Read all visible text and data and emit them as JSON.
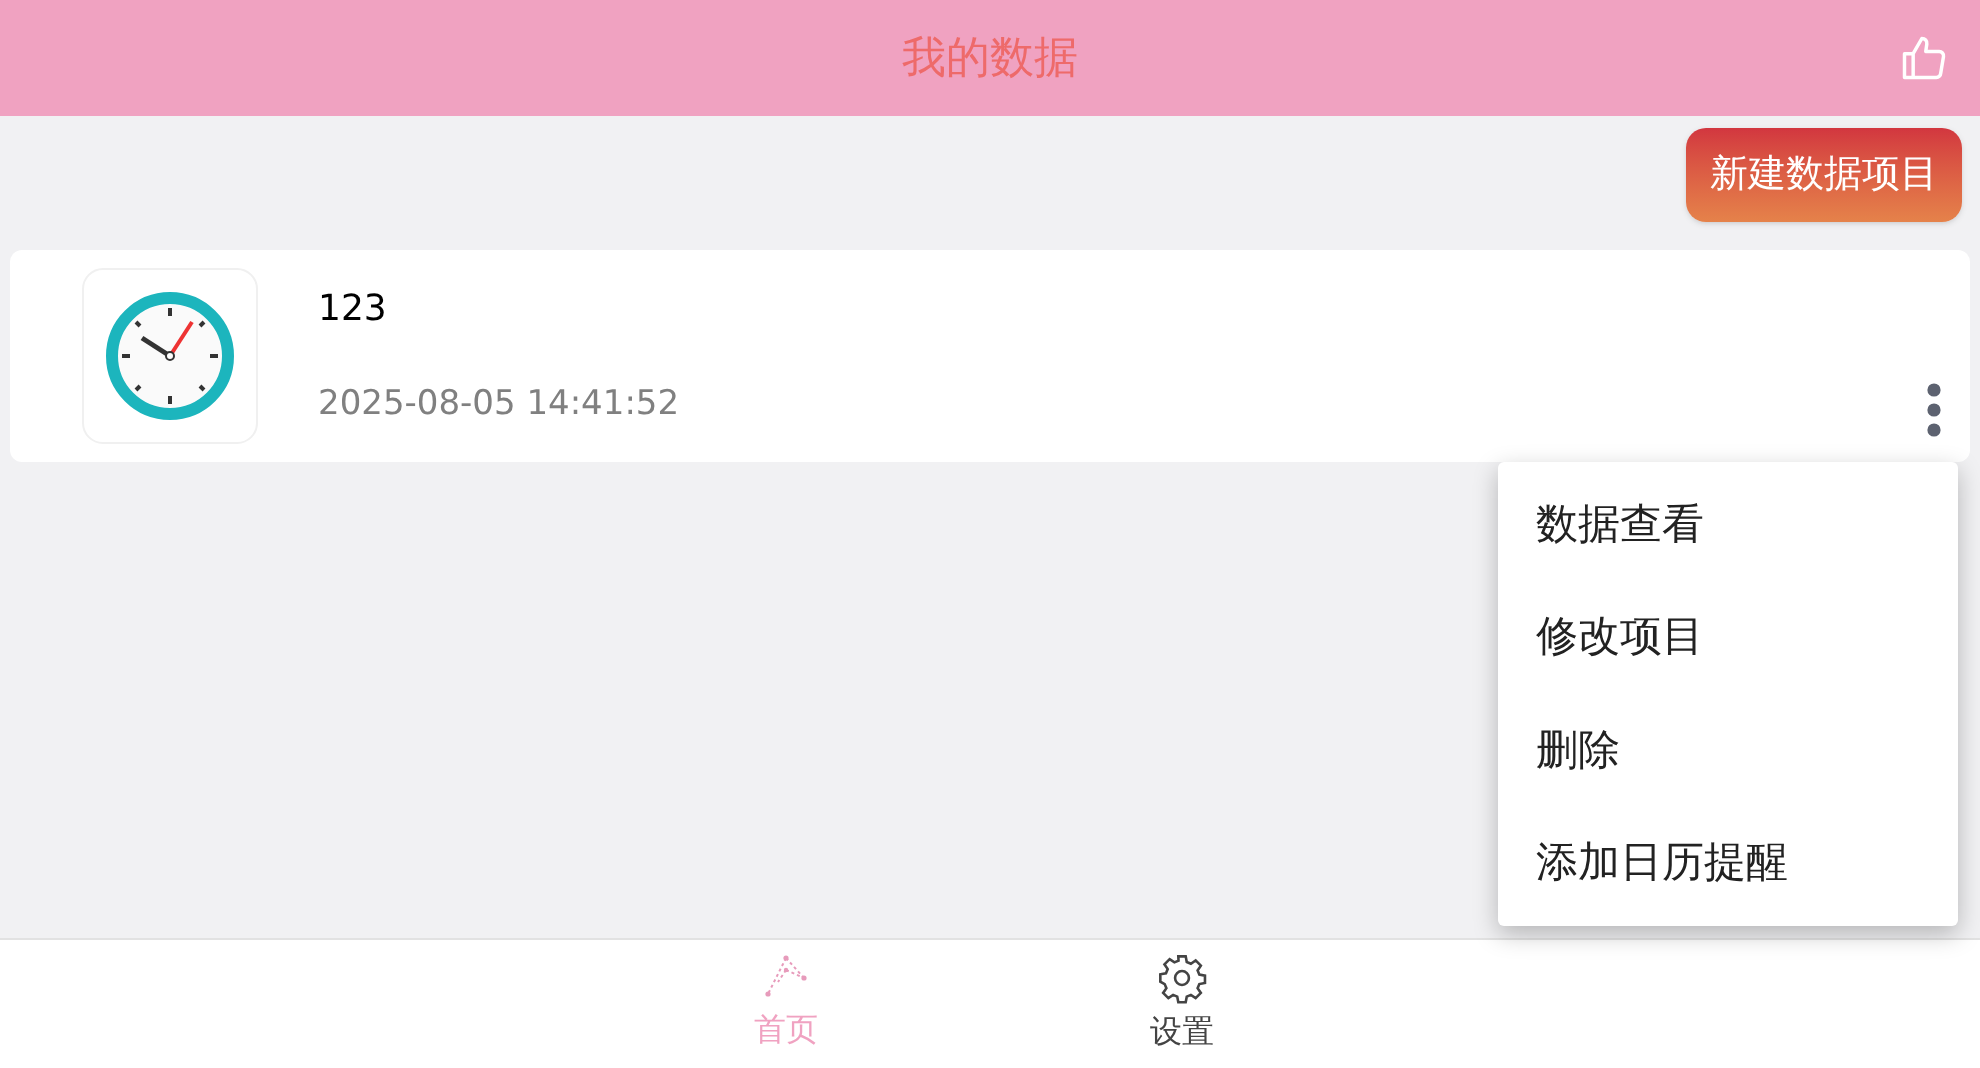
{
  "header": {
    "title": "我的数据"
  },
  "new_button": {
    "label": "新建数据项目"
  },
  "items": [
    {
      "name": "123",
      "time": "2025-08-05 14:41:52"
    }
  ],
  "menu": {
    "items": [
      "数据查看",
      "修改项目",
      "删除",
      "添加日历提醒"
    ]
  },
  "tabs": [
    {
      "label": "首页",
      "selected": true
    },
    {
      "label": "设置",
      "selected": false
    }
  ]
}
